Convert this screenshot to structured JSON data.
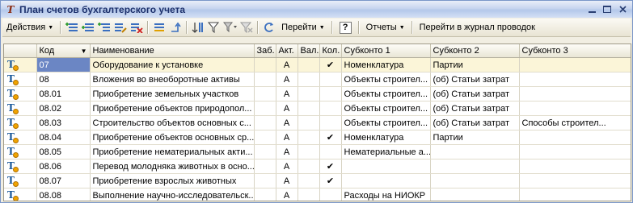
{
  "window": {
    "title": "План счетов бухгалтерского учета"
  },
  "toolbar": {
    "actions_label": "Действия",
    "goto_label": "Перейти",
    "help_label": "?",
    "reports_label": "Отчеты",
    "journal_label": "Перейти в журнал проводок"
  },
  "table": {
    "headers": {
      "code": "Код",
      "name": "Наименование",
      "zab": "Заб.",
      "akt": "Акт.",
      "val": "Вал.",
      "kol": "Кол.",
      "sub1": "Субконто 1",
      "sub2": "Субконто 2",
      "sub3": "Субконто 3"
    },
    "rows": [
      {
        "code": "07",
        "name": "Оборудование к установке",
        "zab": "",
        "akt": "А",
        "val": "",
        "kol": "✔",
        "sub1": "Номенклатура",
        "sub2": "Партии",
        "sub3": ""
      },
      {
        "code": "08",
        "name": "Вложения во внеоборотные активы",
        "zab": "",
        "akt": "А",
        "val": "",
        "kol": "",
        "sub1": "Объекты строител...",
        "sub2": "(об) Статьи затрат",
        "sub3": ""
      },
      {
        "code": "08.01",
        "name": "Приобретение земельных участков",
        "zab": "",
        "akt": "А",
        "val": "",
        "kol": "",
        "sub1": "Объекты строител...",
        "sub2": "(об) Статьи затрат",
        "sub3": ""
      },
      {
        "code": "08.02",
        "name": "Приобретение объектов природопол...",
        "zab": "",
        "akt": "А",
        "val": "",
        "kol": "",
        "sub1": "Объекты строител...",
        "sub2": "(об) Статьи затрат",
        "sub3": ""
      },
      {
        "code": "08.03",
        "name": "Строительство объектов основных с...",
        "zab": "",
        "akt": "А",
        "val": "",
        "kol": "",
        "sub1": "Объекты строител...",
        "sub2": "(об) Статьи затрат",
        "sub3": "Способы строител..."
      },
      {
        "code": "08.04",
        "name": "Приобретение объектов основных ср...",
        "zab": "",
        "akt": "А",
        "val": "",
        "kol": "✔",
        "sub1": "Номенклатура",
        "sub2": "Партии",
        "sub3": ""
      },
      {
        "code": "08.05",
        "name": "Приобретение нематериальных акти...",
        "zab": "",
        "akt": "А",
        "val": "",
        "kol": "",
        "sub1": "Нематериальные а...",
        "sub2": "",
        "sub3": ""
      },
      {
        "code": "08.06",
        "name": "Перевод молодняка животных в осно...",
        "zab": "",
        "akt": "А",
        "val": "",
        "kol": "✔",
        "sub1": "",
        "sub2": "",
        "sub3": ""
      },
      {
        "code": "08.07",
        "name": "Приобретение взрослых животных",
        "zab": "",
        "akt": "А",
        "val": "",
        "kol": "✔",
        "sub1": "",
        "sub2": "",
        "sub3": ""
      },
      {
        "code": "08.08",
        "name": "Выполнение научно-исследовательск...",
        "zab": "",
        "akt": "А",
        "val": "",
        "kol": "",
        "sub1": "Расходы на НИОКР",
        "sub2": "",
        "sub3": ""
      }
    ]
  },
  "colors": {
    "selected_row": "#fbf5d8",
    "selected_cell": "#6b86c4"
  }
}
